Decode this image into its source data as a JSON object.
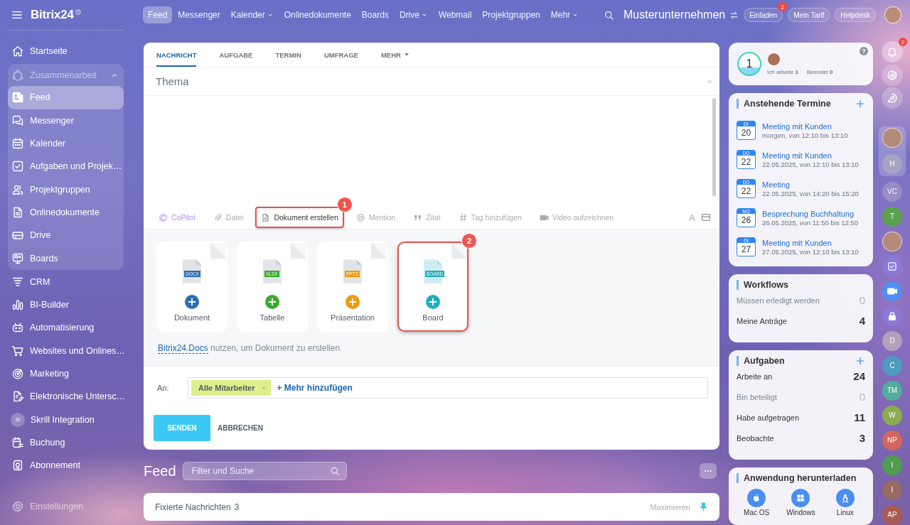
{
  "sidebar": {
    "logo": "Bitrix24",
    "items": [
      {
        "kind": "link",
        "label": "Startseite",
        "selected": false
      },
      {
        "kind": "group",
        "label": "Zusammenarbeit",
        "expanded": true,
        "children": [
          {
            "label": "Feed",
            "selected": true
          },
          {
            "label": "Messenger",
            "selected": false
          },
          {
            "label": "Kalender",
            "selected": false
          },
          {
            "label": "Aufgaben und Projek…",
            "selected": false
          },
          {
            "label": "Projektgruppen",
            "selected": false
          },
          {
            "label": "Onlinedokumente",
            "selected": false
          },
          {
            "label": "Drive",
            "selected": false
          },
          {
            "label": "Boards",
            "selected": false
          }
        ]
      },
      {
        "kind": "link",
        "label": "CRM",
        "selected": false
      },
      {
        "kind": "link",
        "label": "BI-Builder",
        "selected": false
      },
      {
        "kind": "link",
        "label": "Automatisierung",
        "selected": false
      },
      {
        "kind": "link",
        "label": "Websites und Onlines…",
        "selected": false
      },
      {
        "kind": "link",
        "label": "Marketing",
        "selected": false
      },
      {
        "kind": "link",
        "label": "Elektronische Untersc…",
        "selected": false
      },
      {
        "kind": "avatar",
        "label": "Skrill Integration",
        "initials": "SI",
        "selected": false
      },
      {
        "kind": "link",
        "label": "Buchung",
        "selected": false
      },
      {
        "kind": "link",
        "label": "Abonnement",
        "selected": false
      }
    ],
    "settings": "Einstellungen"
  },
  "topbar": {
    "nav": [
      {
        "label": "Feed",
        "selected": true,
        "dropdown": false
      },
      {
        "label": "Messenger",
        "selected": false,
        "dropdown": false
      },
      {
        "label": "Kalender",
        "selected": false,
        "dropdown": true
      },
      {
        "label": "Onlinedokumente",
        "selected": false,
        "dropdown": false
      },
      {
        "label": "Boards",
        "selected": false,
        "dropdown": false
      },
      {
        "label": "Drive",
        "selected": false,
        "dropdown": true
      },
      {
        "label": "Webmail",
        "selected": false,
        "dropdown": false
      },
      {
        "label": "Projektgruppen",
        "selected": false,
        "dropdown": false
      },
      {
        "label": "Mehr",
        "selected": false,
        "dropdown": true
      }
    ],
    "company": "Musterunternehmen",
    "buttons": [
      {
        "label": "Einladen",
        "badge": "2"
      },
      {
        "label": "Mein Tarif"
      },
      {
        "label": "Helpdesk"
      }
    ]
  },
  "composer": {
    "tabs": [
      {
        "label": "NACHRICHT",
        "selected": true,
        "dropdown": false
      },
      {
        "label": "AUFGABE",
        "selected": false,
        "dropdown": false
      },
      {
        "label": "TERMIN",
        "selected": false,
        "dropdown": false
      },
      {
        "label": "UMFRAGE",
        "selected": false,
        "dropdown": false
      },
      {
        "label": "MEHR",
        "selected": false,
        "dropdown": true
      }
    ],
    "subject": {
      "placeholder": "Thema"
    },
    "toolbar": [
      {
        "kind": "ai",
        "label": "CoPilot",
        "highlighted": false
      },
      {
        "kind": "tool",
        "label": "Datei",
        "highlighted": false
      },
      {
        "kind": "tool",
        "label": "Dokument erstellen",
        "highlighted": true,
        "callout": "1"
      },
      {
        "kind": "tool",
        "label": "Mention",
        "highlighted": false
      },
      {
        "kind": "tool",
        "label": "Zitat",
        "highlighted": false
      },
      {
        "kind": "tool",
        "label": "Tag hinzufügen",
        "highlighted": false
      },
      {
        "kind": "tool",
        "label": "Video aufzeichnen",
        "highlighted": false
      }
    ],
    "format_button": "A",
    "doc_cards": [
      {
        "kind": "file",
        "label": "Dokument",
        "file_type": "DOCX",
        "color": "#2d6db0",
        "highlighted": false
      },
      {
        "kind": "file",
        "label": "Tabelle",
        "file_type": "XLSX",
        "color": "#3aa92e",
        "highlighted": false
      },
      {
        "kind": "file",
        "label": "Präsentation",
        "file_type": "PPTX",
        "color": "#eb9b0d",
        "highlighted": false
      },
      {
        "kind": "board",
        "label": "Board",
        "file_type": "BOARD",
        "color": "#1fadbf",
        "highlighted": true,
        "callout": "2"
      }
    ],
    "docs_hint": {
      "link": "Bitrix24.Docs",
      "text": "nutzen, um Dokument zu erstellen"
    },
    "recipients": {
      "label": "An:",
      "tags": [
        {
          "label": "Alle Mitarbeiter"
        }
      ],
      "add_link": "+ Mehr hinzufügen"
    },
    "send": "SENDEN",
    "cancel": "ABBRECHEN"
  },
  "feed": {
    "title": "Feed",
    "filter": {
      "placeholder": "Filter und Suche"
    },
    "pinned": {
      "label": "Fixierte Nachrichten",
      "count": "3",
      "action": "Maximieren"
    }
  },
  "work_status": {
    "count": "1",
    "stats": [
      "Ich arbeite **1**",
      "Beendet **0**"
    ],
    "help": "?"
  },
  "events": {
    "title": "Anstehende Termine",
    "items": [
      {
        "weekday": "DI",
        "day": "20",
        "title": "Meeting mit Kunden",
        "time": "morgen, von 12:10 bis 13:10"
      },
      {
        "weekday": "DO",
        "day": "22",
        "title": "Meeting mit Kunden",
        "time": "22.05.2025, von 12:10 bis 13:10"
      },
      {
        "weekday": "DO",
        "day": "22",
        "title": "Meeting",
        "time": "22.05.2025, von 14:20 bis 15:20"
      },
      {
        "weekday": "MO",
        "day": "26",
        "title": "Besprechung Buchhaltung",
        "time": "26.05.2025, von 11:50 bis 12:50"
      },
      {
        "weekday": "DI",
        "day": "27",
        "title": "Meeting mit Kunden",
        "time": "27.05.2025, von 12:10 bis 13:10"
      }
    ]
  },
  "workflows": {
    "title": "Workflows",
    "rows": [
      {
        "label": "Müssen erledigt werden",
        "value": "0",
        "dimmed": true
      },
      {
        "label": "Meine Anträge",
        "value": "4",
        "dimmed": false
      }
    ]
  },
  "tasks": {
    "title": "Aufgaben",
    "rows": [
      {
        "label": "Arbeite an",
        "value": "24",
        "dimmed": false
      },
      {
        "label": "Bin beteiligt",
        "value": "0",
        "dimmed": true
      },
      {
        "label": "Habe aufgetragen",
        "value": "11",
        "dimmed": false
      },
      {
        "label": "Beobachte",
        "value": "3",
        "dimmed": false
      }
    ]
  },
  "apps": {
    "title": "Anwendung herunterladen",
    "items": [
      {
        "label": "Mac OS"
      },
      {
        "label": "Windows"
      },
      {
        "label": "Linux"
      }
    ]
  },
  "rail": {
    "notifications_badge": "2",
    "pinned": [
      {
        "kind": "photo"
      },
      {
        "kind": "initials",
        "text": "H",
        "color": "#a9a3c2"
      }
    ],
    "contacts": [
      {
        "kind": "initials",
        "text": "VC",
        "color": "#9a8cc6"
      },
      {
        "kind": "initials",
        "text": "T",
        "color": "#5aa24b"
      },
      {
        "kind": "photo"
      },
      {
        "kind": "icon"
      },
      {
        "kind": "icon"
      },
      {
        "kind": "icon"
      },
      {
        "kind": "initials",
        "text": "D",
        "color": "#b39fbe"
      },
      {
        "kind": "initials",
        "text": "C",
        "color": "#4e9bc2"
      },
      {
        "kind": "initials",
        "text": "TM",
        "color": "#52ad9b"
      },
      {
        "kind": "initials",
        "text": "W",
        "color": "#8aab51"
      },
      {
        "kind": "initials",
        "text": "NP",
        "color": "#d2665f"
      },
      {
        "kind": "initials",
        "text": "I",
        "color": "#4f9e4f"
      },
      {
        "kind": "initials",
        "text": "I",
        "color": "#9a6b62"
      },
      {
        "kind": "initials",
        "text": "AP",
        "color": "#a85b52"
      }
    ]
  }
}
